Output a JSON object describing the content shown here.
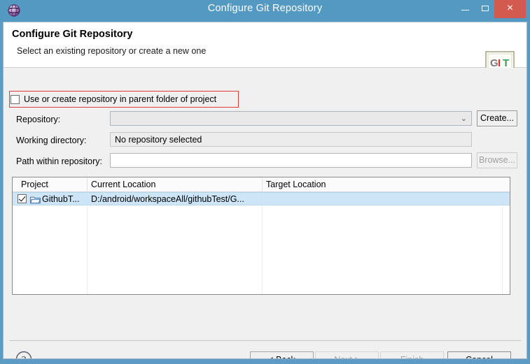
{
  "window": {
    "title": "Configure Git Repository",
    "icon": "eclipse-globe-icon",
    "controls": {
      "minimize": "minimize-button",
      "maximize": "maximize-button",
      "close": "×"
    }
  },
  "header": {
    "title": "Configure Git Repository",
    "subtitle": "Select an existing repository or create a new one",
    "logo": "git-logo",
    "logo_text": "GIT"
  },
  "options": {
    "parent_folder_checkbox": {
      "label": "Use or create repository in parent folder of project",
      "checked": false
    }
  },
  "form": {
    "repository": {
      "label": "Repository:",
      "value": "",
      "placeholder": "",
      "arrow": "⌄"
    },
    "create_button": "Create...",
    "working_directory": {
      "label": "Working directory:",
      "value": "No repository selected"
    },
    "path_within_repository": {
      "label": "Path within repository:",
      "value": "",
      "placeholder": ""
    },
    "browse_button": "Browse..."
  },
  "table": {
    "columns": [
      "Project",
      "Current Location",
      "Target Location"
    ],
    "rows": [
      {
        "checked": true,
        "icon": "project-folder-icon",
        "project": "GithubT...",
        "current_location": "D:/android/workspaceAll/githubTest/G...",
        "target_location": "",
        "selected": true
      }
    ]
  },
  "footer": {
    "help": "?",
    "buttons": [
      {
        "label": "< Back",
        "enabled": true
      },
      {
        "label": "Next >",
        "enabled": false
      },
      {
        "label": "Finish",
        "enabled": false
      },
      {
        "label": "Cancel",
        "enabled": true
      }
    ]
  },
  "annotation": {
    "highlight_color": "#e03b3b",
    "target": "parent-folder-checkbox-row"
  },
  "colors": {
    "titlebar": "#5399c2",
    "close_button": "#d35a4e",
    "selection": "#cde5f7",
    "dialog_background": "#f0f0f0"
  }
}
